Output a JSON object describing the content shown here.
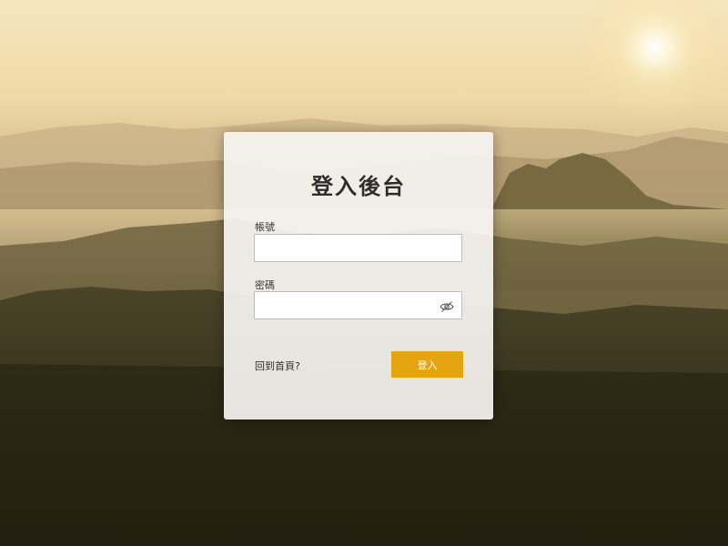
{
  "login": {
    "title": "登入後台",
    "account_label": "帳號",
    "account_value": "",
    "password_label": "密碼",
    "password_value": "",
    "home_link": "回到首頁?",
    "submit_label": "登入"
  },
  "icons": {
    "password_toggle": "eye-slash-icon"
  },
  "colors": {
    "accent": "#e5a50f"
  }
}
